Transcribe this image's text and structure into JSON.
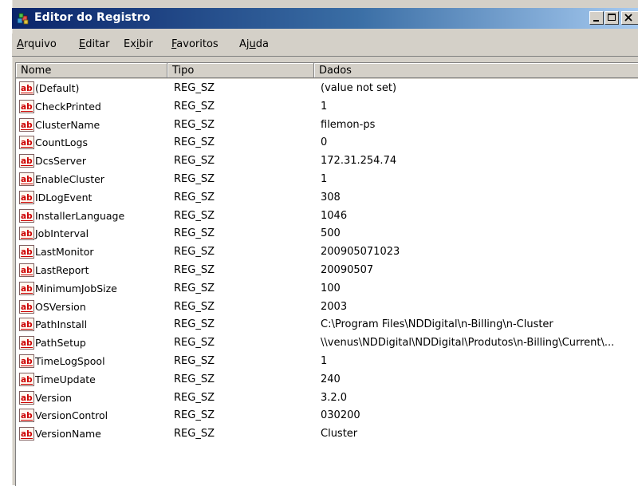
{
  "window": {
    "title": "Editor do Registro"
  },
  "menu": [
    {
      "pre": "",
      "key": "A",
      "post": "rquivo"
    },
    {
      "pre": "",
      "key": "E",
      "post": "ditar"
    },
    {
      "pre": "Ex",
      "key": "i",
      "post": "bir"
    },
    {
      "pre": "",
      "key": "F",
      "post": "avoritos"
    },
    {
      "pre": "Aj",
      "key": "u",
      "post": "da"
    }
  ],
  "columns": {
    "name": "Nome",
    "type": "Tipo",
    "data": "Dados"
  },
  "rows": [
    {
      "name": "(Default)",
      "type": "REG_SZ",
      "data": "(value not set)"
    },
    {
      "name": "CheckPrinted",
      "type": "REG_SZ",
      "data": "1"
    },
    {
      "name": "ClusterName",
      "type": "REG_SZ",
      "data": "filemon-ps"
    },
    {
      "name": "CountLogs",
      "type": "REG_SZ",
      "data": "0"
    },
    {
      "name": "DcsServer",
      "type": "REG_SZ",
      "data": "172.31.254.74"
    },
    {
      "name": "EnableCluster",
      "type": "REG_SZ",
      "data": "1"
    },
    {
      "name": "IDLogEvent",
      "type": "REG_SZ",
      "data": "308"
    },
    {
      "name": "InstallerLanguage",
      "type": "REG_SZ",
      "data": "1046"
    },
    {
      "name": "JobInterval",
      "type": "REG_SZ",
      "data": "500"
    },
    {
      "name": "LastMonitor",
      "type": "REG_SZ",
      "data": "200905071023"
    },
    {
      "name": "LastReport",
      "type": "REG_SZ",
      "data": "20090507"
    },
    {
      "name": "MinimumJobSize",
      "type": "REG_SZ",
      "data": "100"
    },
    {
      "name": "OSVersion",
      "type": "REG_SZ",
      "data": "2003"
    },
    {
      "name": "PathInstall",
      "type": "REG_SZ",
      "data": "C:\\Program Files\\NDDigital\\n-Billing\\n-Cluster"
    },
    {
      "name": "PathSetup",
      "type": "REG_SZ",
      "data": "\\\\venus\\NDDigital\\NDDigital\\Produtos\\n-Billing\\Current\\..."
    },
    {
      "name": "TimeLogSpool",
      "type": "REG_SZ",
      "data": "1"
    },
    {
      "name": "TimeUpdate",
      "type": "REG_SZ",
      "data": "240"
    },
    {
      "name": "Version",
      "type": "REG_SZ",
      "data": "3.2.0"
    },
    {
      "name": "VersionControl",
      "type": "REG_SZ",
      "data": "030200"
    },
    {
      "name": "VersionName",
      "type": "REG_SZ",
      "data": "Cluster"
    }
  ],
  "icons": {
    "app": "regedit-cubes-icon",
    "value": "reg-string-ab-icon"
  },
  "colors": {
    "titlebar_start": "#0a246a",
    "titlebar_end": "#a6caf0",
    "face": "#d4d0c8",
    "ab_icon": "#cc0000"
  }
}
